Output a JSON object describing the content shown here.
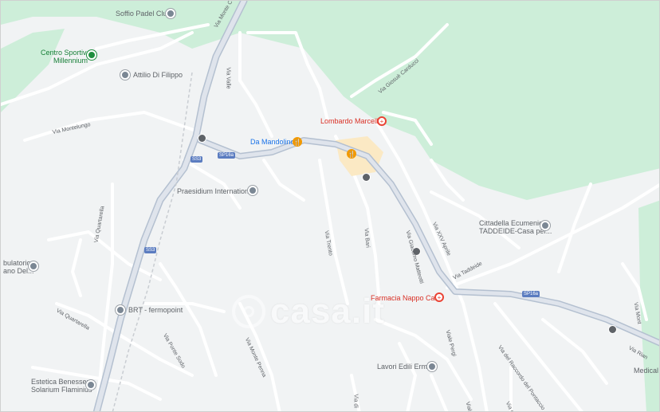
{
  "pois": {
    "soffio": "Soffio Padel Club",
    "centro_1": "Centro Sportivo",
    "centro_2": "Millennium",
    "attilio": "Attilio Di Filippo",
    "mandolino": "Da Mandolino",
    "lombardo": "Lombardo Marcella",
    "praesidium": "Praesidium International",
    "cittadella_1": "Cittadella Ecumenica",
    "cittadella_2": "TADDEIDE-Casa per...",
    "ambulatorio_1": "bulatorio",
    "ambulatorio_2": "ano Del...",
    "brt": "BRT - fermopoint",
    "farmacia": "Farmacia Nappo Carla",
    "lavori": "Lavori Edili Ermal",
    "estetica_1": "Estetica Benessere",
    "estetica_2": "Solarium Flaminius",
    "medical": "Medical"
  },
  "streets": {
    "monte_c": "Via Monte C",
    "valle": "Via Valle",
    "giosue": "Via Giosuè Carducci",
    "montelungo": "Via Montelungo",
    "quartarella_1": "Via Quartarella",
    "quartarella_2": "Via Quartarella",
    "trento": "Via Trento",
    "bari": "Via Bari",
    "giacomo": "Via Giacomo Matteotti",
    "xxv": "Via XXV Aprile",
    "taddeide": "Via Taddeide",
    "pergi": "Viale Pergi",
    "pergi2": "Viale Per",
    "ponte_sodo": "Via Ponte Sodo",
    "monte_penna": "Via Monte Penna",
    "raccordo": "Via del Raccordo del Pontaccio",
    "via_rian": "Via Rian",
    "via_mont": "Via Mont",
    "via_dei": "Via dei",
    "via_kin": "Via di"
  },
  "shields": {
    "ss3_a": "SS3",
    "ss3_b": "SS3",
    "sp16a_a": "SP16a",
    "sp16a_b": "SP16a"
  },
  "watermark": "casa.it",
  "colors": {
    "park": "#cdeed9",
    "road": "#ffffff",
    "major_road": "#c2cbd8",
    "highlight": "#fbe9c4"
  }
}
